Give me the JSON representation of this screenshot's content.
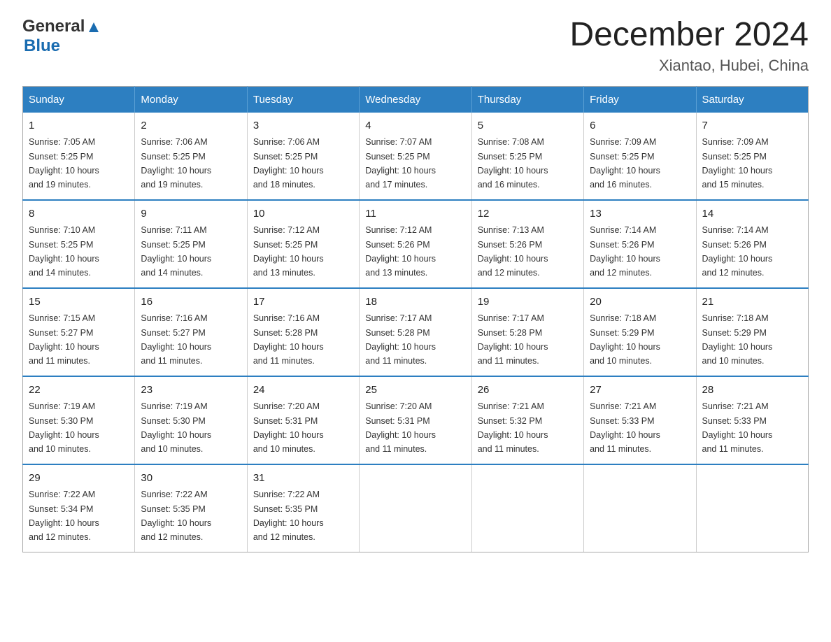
{
  "header": {
    "logo_general": "General",
    "logo_blue": "Blue",
    "month_title": "December 2024",
    "location": "Xiantao, Hubei, China"
  },
  "days_of_week": [
    "Sunday",
    "Monday",
    "Tuesday",
    "Wednesday",
    "Thursday",
    "Friday",
    "Saturday"
  ],
  "weeks": [
    [
      {
        "day": "1",
        "sunrise": "7:05 AM",
        "sunset": "5:25 PM",
        "daylight": "10 hours and 19 minutes."
      },
      {
        "day": "2",
        "sunrise": "7:06 AM",
        "sunset": "5:25 PM",
        "daylight": "10 hours and 19 minutes."
      },
      {
        "day": "3",
        "sunrise": "7:06 AM",
        "sunset": "5:25 PM",
        "daylight": "10 hours and 18 minutes."
      },
      {
        "day": "4",
        "sunrise": "7:07 AM",
        "sunset": "5:25 PM",
        "daylight": "10 hours and 17 minutes."
      },
      {
        "day": "5",
        "sunrise": "7:08 AM",
        "sunset": "5:25 PM",
        "daylight": "10 hours and 16 minutes."
      },
      {
        "day": "6",
        "sunrise": "7:09 AM",
        "sunset": "5:25 PM",
        "daylight": "10 hours and 16 minutes."
      },
      {
        "day": "7",
        "sunrise": "7:09 AM",
        "sunset": "5:25 PM",
        "daylight": "10 hours and 15 minutes."
      }
    ],
    [
      {
        "day": "8",
        "sunrise": "7:10 AM",
        "sunset": "5:25 PM",
        "daylight": "10 hours and 14 minutes."
      },
      {
        "day": "9",
        "sunrise": "7:11 AM",
        "sunset": "5:25 PM",
        "daylight": "10 hours and 14 minutes."
      },
      {
        "day": "10",
        "sunrise": "7:12 AM",
        "sunset": "5:25 PM",
        "daylight": "10 hours and 13 minutes."
      },
      {
        "day": "11",
        "sunrise": "7:12 AM",
        "sunset": "5:26 PM",
        "daylight": "10 hours and 13 minutes."
      },
      {
        "day": "12",
        "sunrise": "7:13 AM",
        "sunset": "5:26 PM",
        "daylight": "10 hours and 12 minutes."
      },
      {
        "day": "13",
        "sunrise": "7:14 AM",
        "sunset": "5:26 PM",
        "daylight": "10 hours and 12 minutes."
      },
      {
        "day": "14",
        "sunrise": "7:14 AM",
        "sunset": "5:26 PM",
        "daylight": "10 hours and 12 minutes."
      }
    ],
    [
      {
        "day": "15",
        "sunrise": "7:15 AM",
        "sunset": "5:27 PM",
        "daylight": "10 hours and 11 minutes."
      },
      {
        "day": "16",
        "sunrise": "7:16 AM",
        "sunset": "5:27 PM",
        "daylight": "10 hours and 11 minutes."
      },
      {
        "day": "17",
        "sunrise": "7:16 AM",
        "sunset": "5:28 PM",
        "daylight": "10 hours and 11 minutes."
      },
      {
        "day": "18",
        "sunrise": "7:17 AM",
        "sunset": "5:28 PM",
        "daylight": "10 hours and 11 minutes."
      },
      {
        "day": "19",
        "sunrise": "7:17 AM",
        "sunset": "5:28 PM",
        "daylight": "10 hours and 11 minutes."
      },
      {
        "day": "20",
        "sunrise": "7:18 AM",
        "sunset": "5:29 PM",
        "daylight": "10 hours and 10 minutes."
      },
      {
        "day": "21",
        "sunrise": "7:18 AM",
        "sunset": "5:29 PM",
        "daylight": "10 hours and 10 minutes."
      }
    ],
    [
      {
        "day": "22",
        "sunrise": "7:19 AM",
        "sunset": "5:30 PM",
        "daylight": "10 hours and 10 minutes."
      },
      {
        "day": "23",
        "sunrise": "7:19 AM",
        "sunset": "5:30 PM",
        "daylight": "10 hours and 10 minutes."
      },
      {
        "day": "24",
        "sunrise": "7:20 AM",
        "sunset": "5:31 PM",
        "daylight": "10 hours and 10 minutes."
      },
      {
        "day": "25",
        "sunrise": "7:20 AM",
        "sunset": "5:31 PM",
        "daylight": "10 hours and 11 minutes."
      },
      {
        "day": "26",
        "sunrise": "7:21 AM",
        "sunset": "5:32 PM",
        "daylight": "10 hours and 11 minutes."
      },
      {
        "day": "27",
        "sunrise": "7:21 AM",
        "sunset": "5:33 PM",
        "daylight": "10 hours and 11 minutes."
      },
      {
        "day": "28",
        "sunrise": "7:21 AM",
        "sunset": "5:33 PM",
        "daylight": "10 hours and 11 minutes."
      }
    ],
    [
      {
        "day": "29",
        "sunrise": "7:22 AM",
        "sunset": "5:34 PM",
        "daylight": "10 hours and 12 minutes."
      },
      {
        "day": "30",
        "sunrise": "7:22 AM",
        "sunset": "5:35 PM",
        "daylight": "10 hours and 12 minutes."
      },
      {
        "day": "31",
        "sunrise": "7:22 AM",
        "sunset": "5:35 PM",
        "daylight": "10 hours and 12 minutes."
      },
      null,
      null,
      null,
      null
    ]
  ],
  "labels": {
    "sunrise": "Sunrise:",
    "sunset": "Sunset:",
    "daylight": "Daylight:"
  }
}
